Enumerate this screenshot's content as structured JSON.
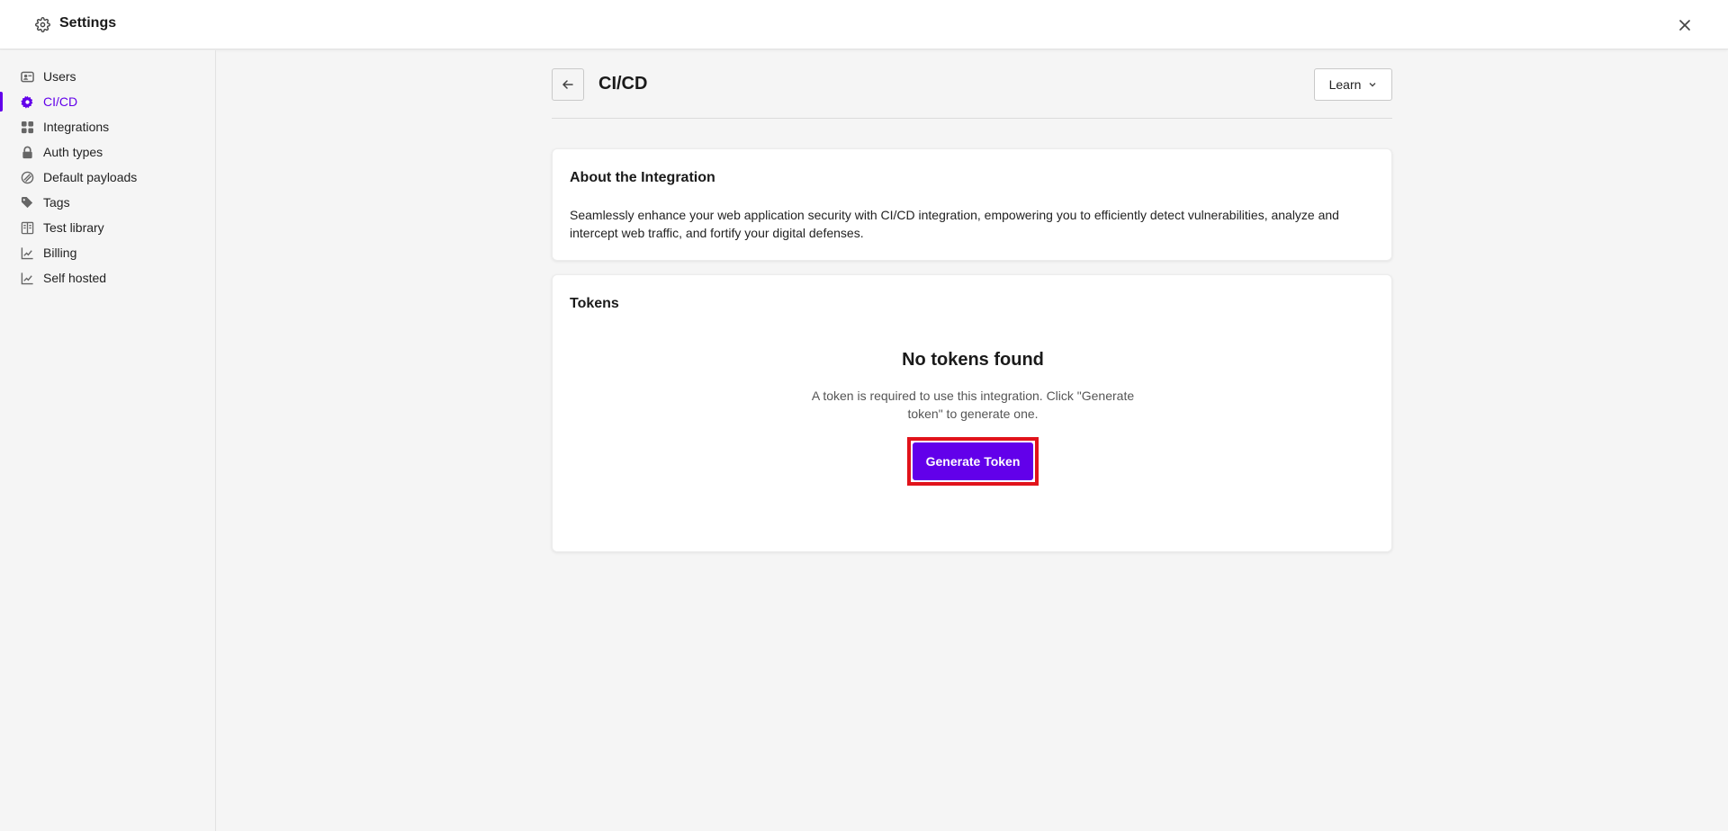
{
  "header": {
    "title": "Settings",
    "settings_icon": "gear-icon",
    "close_icon": "close-icon"
  },
  "sidebar": {
    "accent": "#6200ea",
    "items": [
      {
        "label": "Users",
        "icon": "user-card-icon",
        "active": false
      },
      {
        "label": "CI/CD",
        "icon": "cog-icon",
        "active": true
      },
      {
        "label": "Integrations",
        "icon": "grid-icon",
        "active": false
      },
      {
        "label": "Auth types",
        "icon": "lock-icon",
        "active": false
      },
      {
        "label": "Default payloads",
        "icon": "payload-icon",
        "active": false
      },
      {
        "label": "Tags",
        "icon": "tags-icon",
        "active": false
      },
      {
        "label": "Test library",
        "icon": "book-icon",
        "active": false
      },
      {
        "label": "Billing",
        "icon": "chart-icon",
        "active": false
      },
      {
        "label": "Self hosted",
        "icon": "chart-icon",
        "active": false
      }
    ]
  },
  "main": {
    "title": "CI/CD",
    "learn_label": "Learn",
    "about": {
      "heading": "About the Integration",
      "text": "Seamlessly enhance your web application security with CI/CD integration, empowering you to efficiently detect vulnerabilities, analyze and intercept web traffic, and fortify your digital defenses."
    },
    "tokens": {
      "heading": "Tokens",
      "empty_title": "No tokens found",
      "empty_desc": "A token is required to use this integration. Click \"Generate token\" to generate one.",
      "button_label": "Generate Token",
      "button_color": "#6200ea",
      "highlight_color": "#e1131b"
    }
  }
}
